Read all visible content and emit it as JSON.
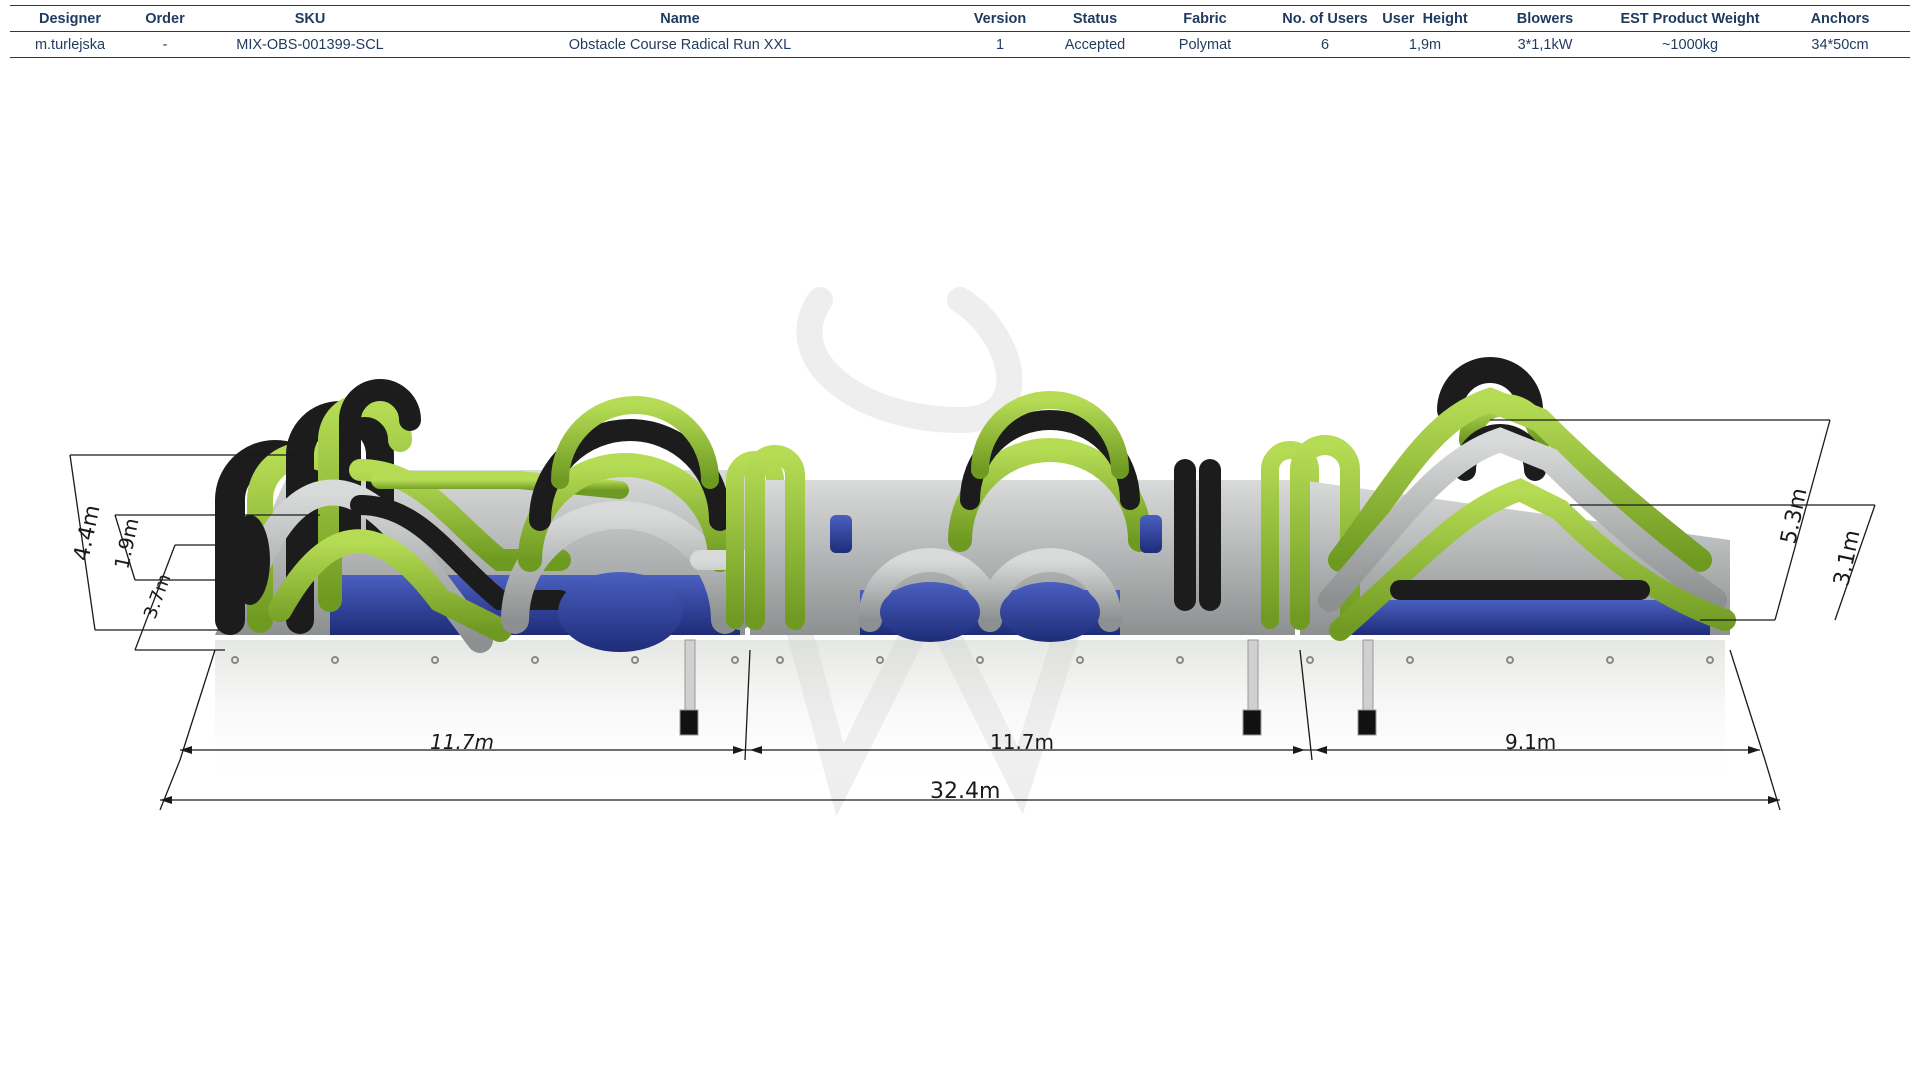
{
  "spec": {
    "headers": [
      "Designer",
      "Order",
      "SKU",
      "Name",
      "Version",
      "Status",
      "Fabric",
      "No. of Users",
      "User  Height",
      "Blowers",
      "EST Product Weight",
      "Anchors"
    ],
    "row": [
      "m.turlejska",
      "-",
      "MIX-OBS-001399-SCL",
      "Obstacle Course Radical Run XXL",
      "1",
      "Accepted",
      "Polymat",
      "6",
      "1,9m",
      "3*1,1kW",
      "~1000kg",
      "34*50cm"
    ]
  },
  "dimensions": {
    "left_height_total": "4.4m",
    "left_user_height": "1.9m",
    "left_depth": "3.7m",
    "right_height_total": "5.3m",
    "right_user_height": "3.1m",
    "section_1_length": "11.7m",
    "section_2_length": "11.7m",
    "section_3_length": "9.1m",
    "total_length": "32.4m"
  },
  "colors": {
    "lime": "#9cc63a",
    "lime_dark": "#6f9a22",
    "grey": "#b9bcbc",
    "black": "#1c1c1c",
    "blue": "#2a3f9e",
    "header_text": "#1f3a5f"
  }
}
